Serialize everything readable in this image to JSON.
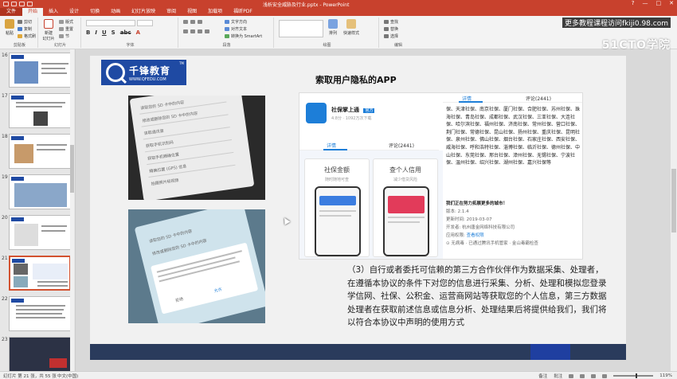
{
  "window": {
    "title": "浅析安全威胁及行业.pptx - PowerPoint",
    "controls": [
      "?",
      "—",
      "□",
      "✕"
    ]
  },
  "ribbon": {
    "tabs": [
      "文件",
      "开始",
      "插入",
      "设计",
      "切换",
      "动画",
      "幻灯片放映",
      "审阅",
      "视图",
      "加载项",
      "福昕PDF"
    ],
    "active_tab": "开始",
    "groups": {
      "clipboard": {
        "label": "剪贴板",
        "paste": "粘贴",
        "cut": "剪切",
        "copy": "复制",
        "format_painter": "格式刷"
      },
      "slides": {
        "label": "幻灯片",
        "new_slide": "新建\n幻灯片",
        "layout": "版式",
        "reset": "重置",
        "section": "节"
      },
      "font": {
        "label": "字体",
        "font_name": "",
        "font_size": ""
      },
      "paragraph": {
        "label": "段落",
        "text_direction": "文字方向",
        "align_text": "对齐文本",
        "smartart": "转换为 SmartArt"
      },
      "drawing": {
        "label": "绘图",
        "arrange": "排列",
        "quick_styles": "快速样式"
      },
      "editing": {
        "label": "编辑",
        "find": "查找",
        "replace": "替换",
        "select": "选择"
      }
    }
  },
  "watermark": {
    "top": "更多教程课程访问fkiji0.98.com",
    "brand": "51CTO学院"
  },
  "thumbnails": {
    "numbers": [
      "16",
      "17",
      "18",
      "19",
      "20",
      "21",
      "22",
      "23"
    ],
    "selected_index": 5
  },
  "slide": {
    "logo_cn": "千锋教育",
    "logo_en": "WWW.QFEDU.COM",
    "logo_tm": "TM",
    "title": "索取用户隐私的APP",
    "photo1_lines": [
      "读取您的 SD 卡中的内容",
      "修改或删除您的 SD 卡中的内容",
      "读取通讯录",
      "获取手机识别码",
      "获取手机精确位置",
      "精确位置 (GPS) 信息",
      "拍摄照片和视频"
    ],
    "photo2_lines": [
      "读取您的 SD 卡中的内容",
      "修改或删除您的 SD 卡中的内容",
      "允许",
      "拒绝"
    ],
    "app": {
      "name": "社保掌上通",
      "badge": "官方",
      "meta": "4.8分 · 1092万次下载",
      "tabs": [
        "详情",
        "评论(2441)"
      ],
      "right_tabs": [
        "详情",
        "评论(2441)"
      ],
      "card1_title": "社保金额",
      "card1_sub": "随时随地可查",
      "card2_title": "查个人信用",
      "card2_sub": "减少借贷风险",
      "cities": "保、天津社保、南京社保、厦门社保、合肥社保、苏州社保、珠海社保、青岛社保、成都社保、武汉社保、三亚社保、大连社保、哈尔滨社保、福州社保、济南社保、常州社保、营口社保、荆门社保、常德社保、昆山社保、扬州社保、重庆社保、昆明社保、泉州社保、佛山社保、烟台社保、石家庄社保、西安社保、威海社保、呼和浩特社保、淄博社保、临沂社保、德州社保、中山社保、东莞社保、邢台社保、漳州社保、无锡社保、宁波社保、温州社保、绍兴社保、湖州社保、嘉兴社保等",
      "expand_line": "我们正在努力拓展更多的城市！",
      "version": "版本: 2.1.4",
      "updated": "更新时间: 2019-03-07",
      "developer": "开发者: 杭州唐金网络科技有限公司",
      "permission": "应用权限:",
      "permission_link": "查看权限",
      "notice": "⊙ 无病毒 · 已通过腾讯手机管家 · 金山毒霸检查"
    },
    "body_text": "（3）自行或者委托可信赖的第三方合作伙伴作为数据采集、处理者，在遵循本协议的条件下对您的信息进行采集、分析、处理和模拟您登录学信网、社保、公积金、运营商网站等获取您的个人信息，第三方数据处理者在获取前述信息或信息分析、处理结果后将提供给我们，我们将以符合本协议中声明的使用方式"
  },
  "status": {
    "slide_info": "幻灯片 第 21 张，共 55 张",
    "language": "中文(中国)",
    "notes": "备注",
    "comments": "批注",
    "zoom": "119%"
  },
  "colors": {
    "accent": "#c8412d",
    "selection": "#d35230",
    "logo_blue": "#1f4aa3",
    "app_blue": "#1d7ed8"
  }
}
